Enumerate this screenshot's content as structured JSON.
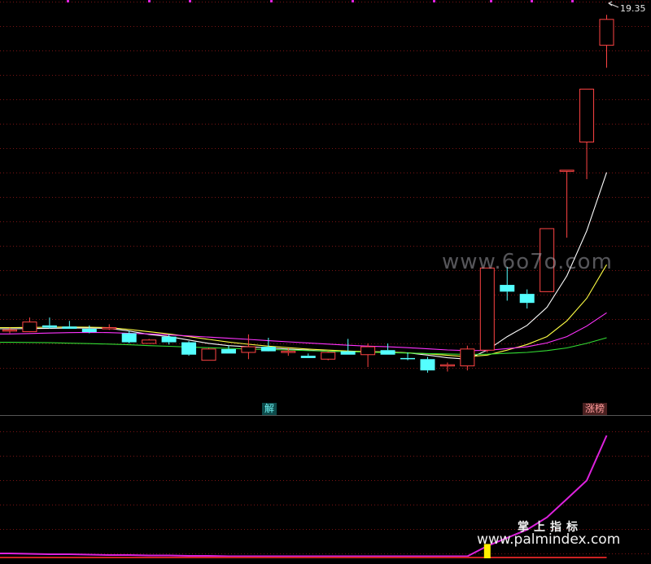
{
  "chart_data": [
    {
      "type": "candlestick",
      "title": "",
      "last_price_label": "19.35",
      "ylim": [
        3.2,
        20.2
      ],
      "candles": [
        {
          "o": 5.85,
          "h": 6.0,
          "l": 5.75,
          "c": 5.9
        },
        {
          "o": 5.82,
          "h": 6.45,
          "l": 5.8,
          "c": 6.25
        },
        {
          "o": 6.1,
          "h": 6.45,
          "l": 5.95,
          "c": 6.0
        },
        {
          "o": 6.05,
          "h": 6.3,
          "l": 5.95,
          "c": 5.95
        },
        {
          "o": 5.95,
          "h": 6.1,
          "l": 5.75,
          "c": 5.8
        },
        {
          "o": 6.0,
          "h": 6.15,
          "l": 5.9,
          "c": 6.0
        },
        {
          "o": 5.75,
          "h": 5.85,
          "l": 5.3,
          "c": 5.35
        },
        {
          "o": 5.3,
          "h": 5.5,
          "l": 5.3,
          "c": 5.45
        },
        {
          "o": 5.6,
          "h": 5.7,
          "l": 5.25,
          "c": 5.35
        },
        {
          "o": 5.35,
          "h": 5.4,
          "l": 4.75,
          "c": 4.8
        },
        {
          "o": 4.55,
          "h": 5.1,
          "l": 4.55,
          "c": 5.05
        },
        {
          "o": 5.05,
          "h": 5.2,
          "l": 4.85,
          "c": 4.85
        },
        {
          "o": 4.9,
          "h": 5.7,
          "l": 4.6,
          "c": 5.15
        },
        {
          "o": 5.15,
          "h": 5.55,
          "l": 5.05,
          "c": 4.95
        },
        {
          "o": 4.95,
          "h": 5.1,
          "l": 4.75,
          "c": 4.95
        },
        {
          "o": 4.75,
          "h": 4.85,
          "l": 4.65,
          "c": 4.65
        },
        {
          "o": 4.6,
          "h": 4.95,
          "l": 4.55,
          "c": 4.9
        },
        {
          "o": 4.95,
          "h": 5.5,
          "l": 4.8,
          "c": 4.8
        },
        {
          "o": 4.8,
          "h": 5.3,
          "l": 4.25,
          "c": 5.15
        },
        {
          "o": 5.0,
          "h": 5.3,
          "l": 4.8,
          "c": 4.8
        },
        {
          "o": 4.65,
          "h": 4.9,
          "l": 4.55,
          "c": 4.6
        },
        {
          "o": 4.6,
          "h": 4.7,
          "l": 4.0,
          "c": 4.1
        },
        {
          "o": 4.35,
          "h": 4.45,
          "l": 4.05,
          "c": 4.35
        },
        {
          "o": 4.3,
          "h": 5.2,
          "l": 4.1,
          "c": 5.05
        },
        {
          "o": 5.0,
          "h": 8.65,
          "l": 4.9,
          "c": 8.65
        },
        {
          "o": 7.9,
          "h": 8.7,
          "l": 7.2,
          "c": 7.6
        },
        {
          "o": 7.5,
          "h": 7.7,
          "l": 6.85,
          "c": 7.1
        },
        {
          "o": 7.6,
          "h": 10.4,
          "l": 7.6,
          "c": 10.4
        },
        {
          "o": 13.0,
          "h": 13.0,
          "l": 10.0,
          "c": 13.0
        },
        {
          "o": 14.25,
          "h": 16.6,
          "l": 12.6,
          "c": 16.6
        },
        {
          "o": 18.55,
          "h": 19.9,
          "l": 17.55,
          "c": 19.7
        }
      ],
      "moving_averages": [
        {
          "color": "#ffffff",
          "values": [
            5.95,
            5.96,
            5.97,
            5.98,
            5.98,
            5.97,
            5.85,
            5.7,
            5.6,
            5.45,
            5.3,
            5.2,
            5.15,
            5.1,
            5.05,
            5.0,
            4.95,
            4.93,
            4.93,
            4.92,
            4.88,
            4.78,
            4.66,
            4.6,
            5.0,
            5.6,
            6.1,
            6.9,
            8.3,
            10.3,
            12.9
          ]
        },
        {
          "color": "#ffff44",
          "values": [
            6.0,
            6.01,
            6.02,
            6.03,
            6.02,
            6.0,
            5.92,
            5.82,
            5.72,
            5.6,
            5.48,
            5.36,
            5.26,
            5.18,
            5.11,
            5.05,
            5.0,
            4.96,
            4.93,
            4.91,
            4.88,
            4.84,
            4.77,
            4.71,
            4.78,
            5.0,
            5.25,
            5.6,
            6.3,
            7.3,
            8.8
          ]
        },
        {
          "color": "#ff33ff",
          "values": [
            5.72,
            5.74,
            5.76,
            5.78,
            5.79,
            5.78,
            5.75,
            5.72,
            5.68,
            5.63,
            5.58,
            5.53,
            5.48,
            5.42,
            5.37,
            5.32,
            5.27,
            5.22,
            5.18,
            5.15,
            5.11,
            5.06,
            5.01,
            4.98,
            4.99,
            5.07,
            5.15,
            5.32,
            5.6,
            6.07,
            6.66
          ]
        },
        {
          "color": "#33dd33",
          "values": [
            5.35,
            5.34,
            5.33,
            5.31,
            5.29,
            5.27,
            5.24,
            5.2,
            5.17,
            5.14,
            5.11,
            5.08,
            5.05,
            5.03,
            5.01,
            4.98,
            4.95,
            4.93,
            4.91,
            4.89,
            4.87,
            4.85,
            4.83,
            4.81,
            4.82,
            4.86,
            4.9,
            4.98,
            5.1,
            5.3,
            5.55
          ]
        }
      ],
      "markers": [
        {
          "index": 13,
          "text": "解",
          "style": "cyan"
        },
        {
          "index": 29,
          "text": "涨榜",
          "style": "red"
        }
      ]
    },
    {
      "type": "line",
      "title": "",
      "ylim": [
        0,
        3.3
      ],
      "series": [
        {
          "color": "#dd22dd",
          "values": [
            0.12,
            0.11,
            0.1,
            0.1,
            0.09,
            0.08,
            0.08,
            0.07,
            0.07,
            0.06,
            0.06,
            0.05,
            0.05,
            0.05,
            0.05,
            0.05,
            0.05,
            0.05,
            0.05,
            0.05,
            0.05,
            0.05,
            0.05,
            0.05,
            0.3,
            0.5,
            0.7,
            1.0,
            1.45,
            1.9,
            3.0
          ]
        },
        {
          "color": "#cc2222",
          "values": [
            0.02,
            0.02,
            0.02,
            0.02,
            0.02,
            0.02,
            0.02,
            0.02,
            0.02,
            0.02,
            0.02,
            0.02,
            0.02,
            0.02,
            0.02,
            0.02,
            0.02,
            0.02,
            0.02,
            0.02,
            0.02,
            0.02,
            0.02,
            0.02,
            0.02,
            0.02,
            0.02,
            0.02,
            0.02,
            0.02,
            0.02
          ]
        }
      ],
      "highlight_bar": {
        "index": 24,
        "value": 0.35,
        "color": "#ffee00"
      }
    }
  ],
  "watermarks": {
    "top": "www.6o7o.com",
    "bottom_cn": "掌上指标",
    "bottom_url": "www.palmindex.com"
  },
  "colors": {
    "up": "#ff4444",
    "down": "#54ffff",
    "grid": "#7a1414",
    "separator": "#555555"
  }
}
